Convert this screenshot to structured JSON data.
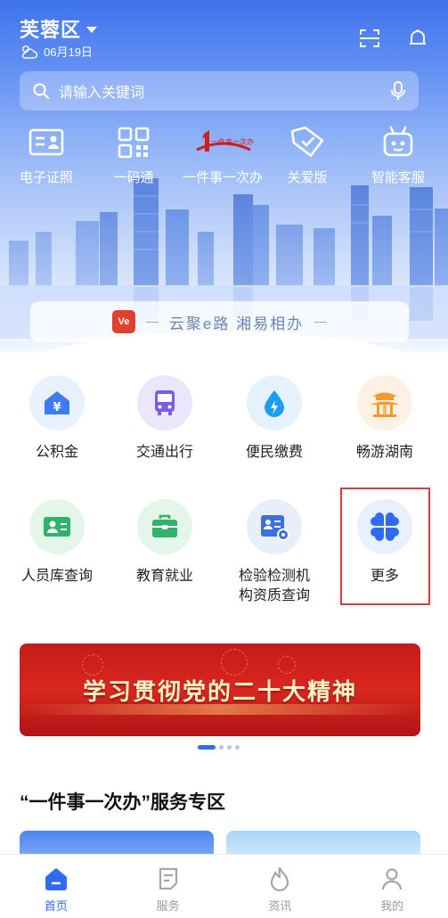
{
  "header": {
    "location": "芙蓉区",
    "date": "06月19日",
    "icons": [
      "scan-icon",
      "bell-icon"
    ]
  },
  "search": {
    "placeholder": "请输入关键词",
    "icons": [
      "search-icon",
      "microphone-icon"
    ]
  },
  "quick_actions": [
    {
      "label": "电子证照",
      "icon": "id-card-icon"
    },
    {
      "label": "一码通",
      "icon": "qr-code-icon"
    },
    {
      "label": "一件事一次办",
      "icon": "one-thing-logo-icon",
      "logo_text": "一件事一次办"
    },
    {
      "label": "关爱版",
      "icon": "tag-heart-icon"
    },
    {
      "label": "智能客服",
      "icon": "robot-icon"
    }
  ],
  "slogan": {
    "logo_text": "Ve",
    "text": "云聚e路 湘易相办"
  },
  "services": [
    {
      "label": "公积金",
      "icon": "yuan-house-icon",
      "color": "#e8f1ff"
    },
    {
      "label": "交通出行",
      "icon": "bus-icon",
      "color": "#eae6fb"
    },
    {
      "label": "便民缴费",
      "icon": "water-drop-icon",
      "color": "#e4f2fd"
    },
    {
      "label": "畅游湖南",
      "icon": "pavilion-icon",
      "color": "#fdf1e3"
    },
    {
      "label": "人员库查询",
      "icon": "person-card-icon",
      "color": "#e4f6ea"
    },
    {
      "label": "教育就业",
      "icon": "briefcase-icon",
      "color": "#e4f6ea"
    },
    {
      "label": "检验检测机构资质查询",
      "label_lines": [
        "检验检测机",
        "构资质查询"
      ],
      "icon": "certificate-icon",
      "color": "#e9eefb"
    },
    {
      "label": "更多",
      "icon": "four-petal-icon",
      "color": "#e8f0ff"
    }
  ],
  "promo_banner": {
    "text": "学习贯彻党的二十大精神",
    "pages": 4,
    "active_page": 1
  },
  "section": {
    "title": "“一件事一次办”服务专区"
  },
  "tabbar": [
    {
      "label": "首页",
      "icon": "home-icon",
      "active": true
    },
    {
      "label": "服务",
      "icon": "document-icon",
      "active": false
    },
    {
      "label": "资讯",
      "icon": "flame-icon",
      "active": false
    },
    {
      "label": "我的",
      "icon": "user-icon",
      "active": false
    }
  ],
  "colors": {
    "accent": "#2f6af0",
    "highlight_box": "#e0393a",
    "promo_red": "#c41a1a"
  }
}
